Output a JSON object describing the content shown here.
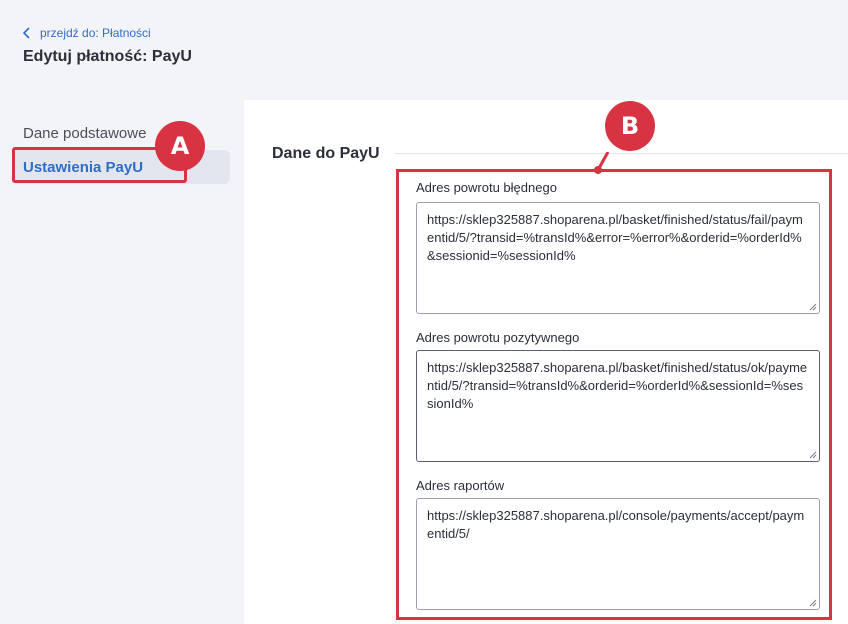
{
  "nav": {
    "back_label": "przejdź do: Płatności",
    "back_icon": "chevron-left-icon"
  },
  "page": {
    "title": "Edytuj płatność: PayU"
  },
  "sidebar": {
    "items": [
      {
        "label": "Dane podstawowe",
        "active": false
      },
      {
        "label": "Ustawienia PayU",
        "active": true
      }
    ]
  },
  "section": {
    "title": "Dane do PayU"
  },
  "fields": [
    {
      "label": "Adres powrotu błędnego",
      "value": "https://sklep325887.shoparena.pl/basket/finished/status/fail/paymentid/5/?transid=%transId%&error=%error%&orderid=%orderId%&sessionid=%sessionId%"
    },
    {
      "label": "Adres powrotu pozytywnego",
      "value": "https://sklep325887.shoparena.pl/basket/finished/status/ok/paymentid/5/?transid=%transId%&orderid=%orderId%&sessionId=%sessionId%"
    },
    {
      "label": "Adres raportów",
      "value": "https://sklep325887.shoparena.pl/console/payments/accept/paymentid/5/"
    }
  ],
  "annotations": {
    "a": "A",
    "b": "B"
  },
  "colors": {
    "accent": "#2f6ec7",
    "annotation": "#d83343",
    "background": "#f3f4f7"
  }
}
